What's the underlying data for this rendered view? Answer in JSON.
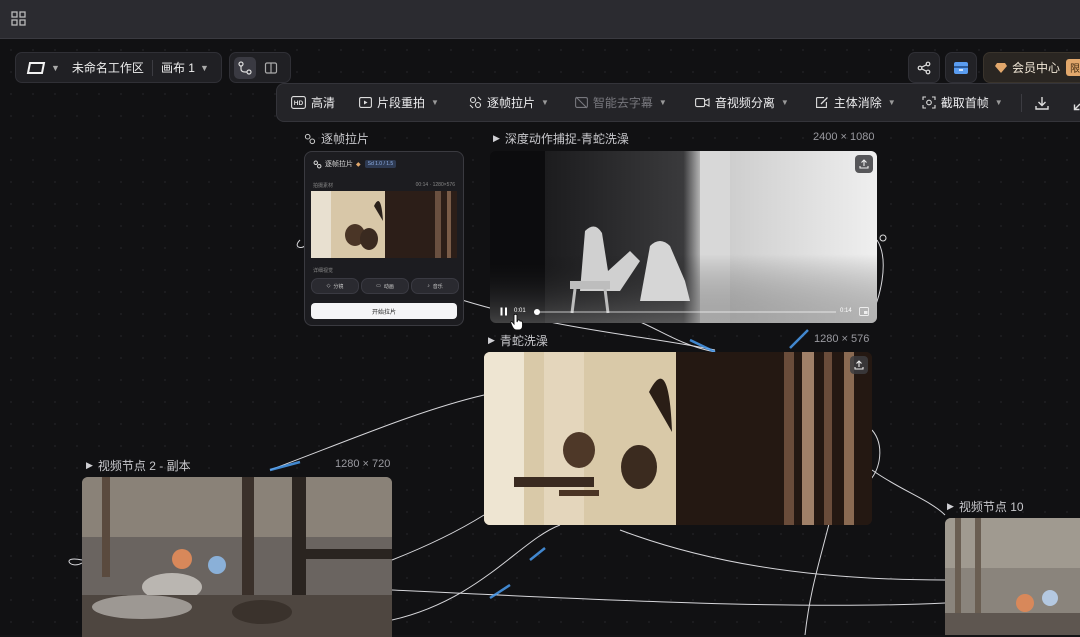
{
  "workspace": {
    "name": "未命名工作区",
    "canvas": "画布 1"
  },
  "member": {
    "label": "会员中心",
    "tag": "限时"
  },
  "toolbar": {
    "items": [
      {
        "label": "高清",
        "icon": "hd-icon"
      },
      {
        "label": "片段重拍",
        "icon": "clip-retake-icon"
      },
      {
        "label": "逐帧拉片",
        "icon": "frame-icon"
      },
      {
        "label": "智能去字幕",
        "icon": "subtitle-remove-icon"
      },
      {
        "label": "音视频分离",
        "icon": "av-split-icon"
      },
      {
        "label": "主体消除",
        "icon": "erase-icon"
      },
      {
        "label": "截取首帧",
        "icon": "capture-icon"
      }
    ]
  },
  "nodes": {
    "frame_panel": {
      "title": "逐帧拉片",
      "header": "逐帧拉片",
      "badge": "Sd 1.0 / 1.5",
      "section1": "拍摄素材",
      "section1_meta": "00:14 · 1280×576",
      "section2": "详细视觉",
      "chips": [
        "分镜",
        "动画",
        "音乐"
      ],
      "button": "开始拉片"
    },
    "depth": {
      "title": "深度动作捕捉-青蛇洗澡",
      "dims": "2400 × 1080",
      "time_start": "0:01",
      "time_end": "0:14"
    },
    "qingshe": {
      "title": "青蛇洗澡",
      "dims": "1280 × 576"
    },
    "node2": {
      "title": "视频节点 2 - 副本",
      "dims": "1280 × 720"
    },
    "node10": {
      "title": "视频节点 10"
    }
  },
  "colors": {
    "accent": "#4a9cf0",
    "wire": "#d8d8dc",
    "member": "#e2a86c"
  }
}
